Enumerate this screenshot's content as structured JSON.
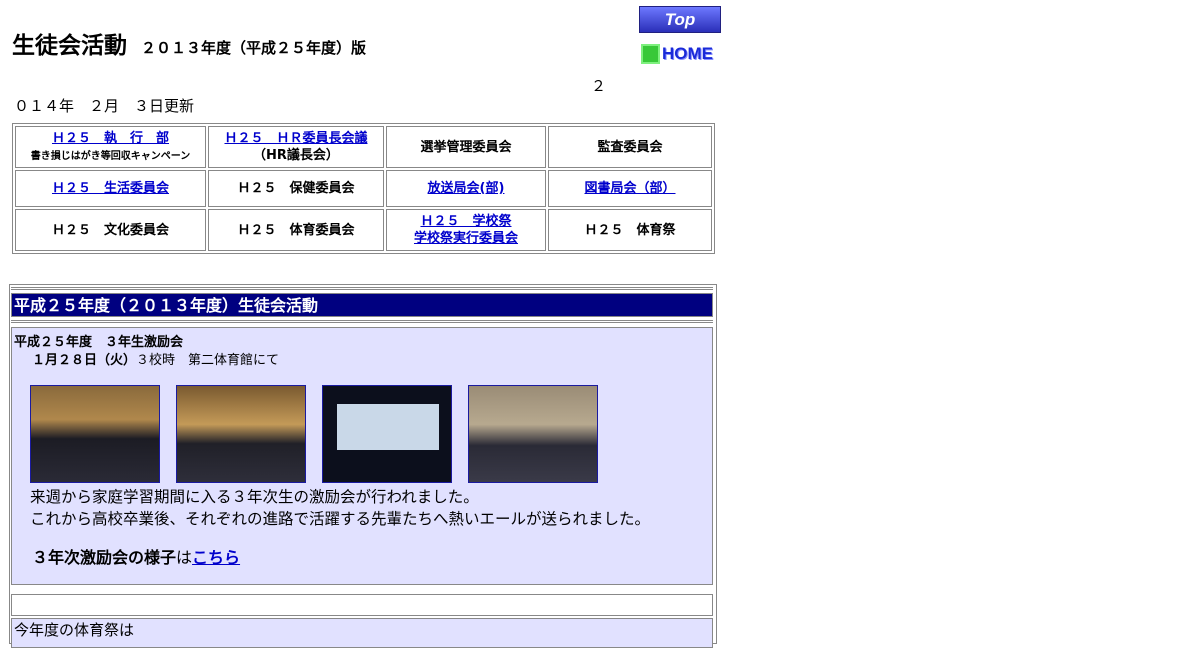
{
  "header": {
    "title": "生徒会活動",
    "subtitle": "２０１３年度（平成２５年度）版",
    "top_button": "Top",
    "home_button": "HOME",
    "update_line1": "２",
    "update_line2": "０１４年　２月　３日更新"
  },
  "nav": {
    "rows": [
      [
        {
          "label": "Ｈ２５　執　行　部",
          "sub": "書き損じはがき等回収キャンペーン",
          "link": true
        },
        {
          "label": "Ｈ２５　ＨＲ委員長会議",
          "sub": "（HR議長会）",
          "link": true
        },
        {
          "label": "選挙管理委員会",
          "link": false
        },
        {
          "label": "監査委員会",
          "link": false
        }
      ],
      [
        {
          "label": "Ｈ２５　生活委員会",
          "link": true
        },
        {
          "label": "Ｈ２５　保健委員会",
          "link": false
        },
        {
          "label": "放送局会(部)",
          "link": true
        },
        {
          "label": "図書局会（部）",
          "link": true
        }
      ],
      [
        {
          "label": "Ｈ２５　文化委員会",
          "link": false
        },
        {
          "label": "Ｈ２５　体育委員会",
          "link": false
        },
        {
          "label": "Ｈ２５　学校祭",
          "sub": "学校祭実行委員会",
          "link": true
        },
        {
          "label": "Ｈ２５　体育祭",
          "link": false
        }
      ]
    ]
  },
  "section": {
    "heading": "平成２５年度（２０１３年度）生徒会活動",
    "event": {
      "title": "平成２５年度　３年生激励会",
      "date": "１月２８日（火）",
      "place": "３校時　第二体育館にて",
      "body_line1": "来週から家庭学習期間に入る３年次生の激励会が行われました。",
      "body_line2": "これから高校卒業後、それぞれの進路で活躍する先輩たちへ熱いエールが送られました。",
      "link_prefix": "３年次激励会の様子",
      "link_mid": "は",
      "link_text": "こちら"
    },
    "next_text": "今年度の体育祭は"
  },
  "colors": {
    "heading_bg": "#000080",
    "panel_bg": "#e1e1ff",
    "link": "#0000cc"
  }
}
